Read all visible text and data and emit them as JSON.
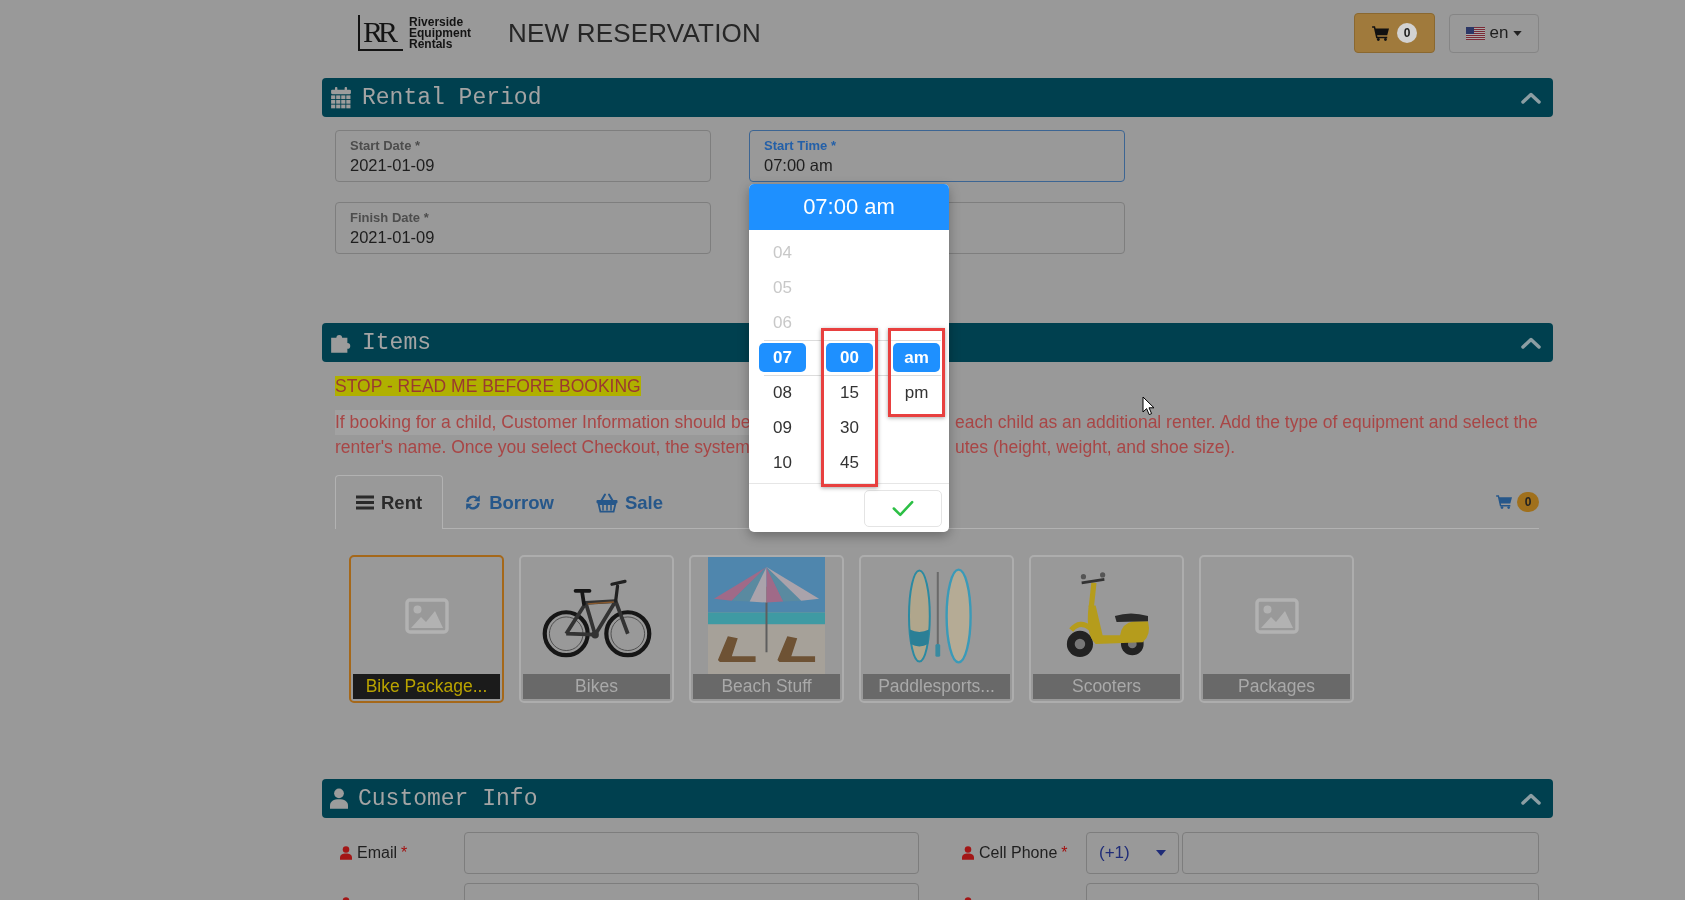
{
  "logo": {
    "monogram": "RR",
    "lines": [
      "Riverside",
      "Equipment",
      "Rentals"
    ]
  },
  "page_title": "NEW RESERVATION",
  "cart_button": {
    "count": "0"
  },
  "language_button": {
    "label": "en"
  },
  "rental_period": {
    "title": "Rental Period",
    "expanded": true,
    "fields": [
      {
        "label": "Start Date *",
        "value": "2021-01-09",
        "focused": false
      },
      {
        "label": "Start Time *",
        "value": "07:00 am",
        "focused": true
      },
      {
        "label": "Finish Date *",
        "value": "2021-01-09",
        "focused": false
      },
      {
        "focused": false
      }
    ]
  },
  "time_picker": {
    "display": "07:00 am",
    "columns": [
      {
        "annotated": false,
        "options": [
          {
            "label": "04",
            "disabled": true,
            "selected": false
          },
          {
            "label": "05",
            "disabled": true,
            "selected": false
          },
          {
            "label": "06",
            "disabled": true,
            "selected": false
          },
          {
            "label": "07",
            "disabled": false,
            "selected": true
          },
          {
            "label": "08",
            "disabled": false,
            "selected": false
          },
          {
            "label": "09",
            "disabled": false,
            "selected": false
          },
          {
            "label": "10",
            "disabled": false,
            "selected": false
          }
        ]
      },
      {
        "annotated": true,
        "options": [
          {
            "label": "00",
            "disabled": false,
            "selected": true
          },
          {
            "label": "15",
            "disabled": false,
            "selected": false
          },
          {
            "label": "30",
            "disabled": false,
            "selected": false
          },
          {
            "label": "45",
            "disabled": false,
            "selected": false
          }
        ]
      },
      {
        "annotated": true,
        "options": [
          {
            "label": "am",
            "disabled": false,
            "selected": true
          },
          {
            "label": "pm",
            "disabled": false,
            "selected": false
          }
        ]
      }
    ]
  },
  "items": {
    "title": "Items",
    "expanded": true,
    "notice": {
      "heading": "STOP - READ ME BEFORE BOOKING",
      "lines": [
        {
          "left": "If booking for a child, Customer Information should be",
          "right": "each child as an additional renter. Add the type of equipment and select the",
          "highlighted": true
        },
        {
          "left": "renter's name. Once you select Checkout, the system",
          "right": "utes (height, weight, and shoe size).",
          "highlighted": false
        }
      ]
    },
    "tabs": [
      {
        "label": "Rent",
        "selected": true
      },
      {
        "label": "Borrow",
        "selected": false
      },
      {
        "label": "Sale",
        "selected": false
      }
    ],
    "cart_count": "0",
    "categories": [
      {
        "label": "Bike Package...",
        "kind": "placeholder",
        "selected": true
      },
      {
        "label": "Bikes",
        "kind": "bicycle",
        "selected": false
      },
      {
        "label": "Beach Stuff",
        "kind": "beach",
        "selected": false
      },
      {
        "label": "Paddlesports...",
        "kind": "paddleboard",
        "selected": false
      },
      {
        "label": "Scooters",
        "kind": "scooter",
        "selected": false
      },
      {
        "label": "Packages",
        "kind": "placeholder",
        "selected": false
      }
    ]
  },
  "customer_info": {
    "title": "Customer Info",
    "expanded": true,
    "rows": [
      [
        {
          "kind": "text",
          "label": "Email",
          "required_mark": "*"
        },
        {
          "kind": "phone",
          "label": "Cell Phone",
          "required_mark": "*",
          "country_code": "(+1)"
        }
      ],
      [
        {
          "kind": "text"
        },
        {
          "kind": "text"
        }
      ]
    ]
  }
}
